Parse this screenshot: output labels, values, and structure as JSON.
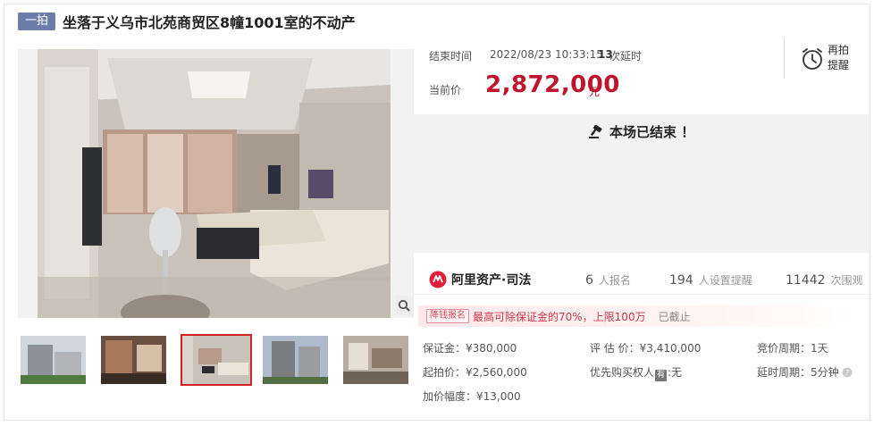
{
  "header": {
    "round_badge": "一拍",
    "title": "坐落于义乌市北苑商贸区8幢1001室的不动产"
  },
  "auction": {
    "end_time_label": "结束时间",
    "end_time": "2022/08/23 10:33:15",
    "delay_count": "13",
    "delay_unit": "次延时",
    "current_price_label": "当前价",
    "current_price": "2,872,000",
    "currency_unit": "元",
    "remind_label": "再拍提醒",
    "ended_text": "本场已结束 ！"
  },
  "platform": {
    "logo_text": "阿里资产·司法"
  },
  "stats": {
    "signups_num": "6",
    "signups_label": "人报名",
    "reminders_num": "194",
    "reminders_label": "人设置提醒",
    "watchers_num": "11442",
    "watchers_label": "次围观"
  },
  "notice": {
    "badge": "降钱报名",
    "text": "最高可除保证金的70%，上限100万",
    "status": "已截止"
  },
  "details": {
    "deposit": "保证金：¥380,000",
    "start_price": "起拍价：¥2,560,000",
    "increment": "加价幅度：¥13,000",
    "valuation": "评 估 价：¥3,410,000",
    "priority_buyer_prefix": "优先购买权人",
    "priority_buyer_icon": "有",
    "priority_buyer_value": ":无",
    "bidding_period": "竞价周期：1天",
    "delay_period": "延时周期：5分钟"
  },
  "icons": {
    "zoom": "search-icon",
    "remind": "alarm-clock-icon",
    "ended": "gavel-icon",
    "logo": "ali-asset-logo",
    "help": "help-icon"
  },
  "colors": {
    "price": "#c1132d",
    "badge": "#6c7ea7",
    "thumb_active_border": "#d42121"
  }
}
